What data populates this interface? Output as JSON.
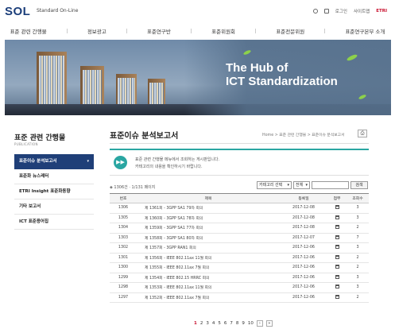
{
  "header": {
    "logo": "SOL",
    "logo_sub": "Standard On-Line",
    "util_links": [
      "로그인",
      "사이트맵",
      "ETRI"
    ]
  },
  "gnb": [
    "표준 관련 간행물",
    "정보광고",
    "표준연구반",
    "표준위원회",
    "표준전문위원",
    "표준연구본부 소개"
  ],
  "hero": {
    "line1": "The Hub of",
    "line2": "ICT Standardization"
  },
  "sidebar": {
    "title": "표준 관련 간행물",
    "subtitle": "PUBLICATION",
    "items": [
      {
        "label": "표준이슈 분석보고서",
        "active": true
      },
      {
        "label": "표준화 뉴스레터"
      },
      {
        "label": "ETRI Insight 표준화동향"
      },
      {
        "label": "기타 보고서"
      },
      {
        "label": "ICT 표준용어집"
      }
    ]
  },
  "main": {
    "title": "표준이슈 분석보고서",
    "breadcrumb": "Home > 표준 관련 간행물 > 표준이슈 분석보고서",
    "notice_line1": "표준 관련 간행물 메뉴에서 조회하는 게시판입니다.",
    "notice_line2": "카테고리의 내용을 확인하시기 바랍니다.",
    "count_text": "◈ 1306건 · 1/131 페이지",
    "filter_category": "카테고리 선택",
    "filter_scope": "전체",
    "search_value": "",
    "search_label": "검색"
  },
  "table": {
    "columns": [
      "번호",
      "제목",
      "등록일",
      "첨부",
      "조회수"
    ],
    "rows": [
      [
        "1306",
        "제 1361회 - 3GPP SA1 79차 회의",
        "2017-12-08",
        "3"
      ],
      [
        "1305",
        "제 1360회 - 3GPP SA1 78차 회의",
        "2017-12-08",
        "3"
      ],
      [
        "1304",
        "제 1359회 - 3GPP SA1 77차 회의",
        "2017-12-08",
        "2"
      ],
      [
        "1303",
        "제 1358회 - 3GPP SA1 80차 회의",
        "2017-12-07",
        "7"
      ],
      [
        "1302",
        "제 1357회 - 3GPP RAN1 회의",
        "2017-12-06",
        "3"
      ],
      [
        "1301",
        "제 1356회 - IEEE 802.11ax 11월 회의",
        "2017-12-06",
        "2"
      ],
      [
        "1300",
        "제 1355회 - IEEE 802.11ax 7월 회의",
        "2017-12-06",
        "2"
      ],
      [
        "1299",
        "제 1354회 - IEEE 802.15 HRRC 회의",
        "2017-12-06",
        "3"
      ],
      [
        "1298",
        "제 1353회 - IEEE 802.11ax 11월 회의",
        "2017-12-06",
        "3"
      ],
      [
        "1297",
        "제 1352회 - IEEE 802.11ax 7월 회의",
        "2017-12-06",
        "2"
      ]
    ]
  },
  "pager": {
    "pages": [
      "1",
      "2",
      "3",
      "4",
      "5",
      "6",
      "7",
      "8",
      "9",
      "10"
    ],
    "current": "1",
    "next": "›",
    "last": "»"
  }
}
